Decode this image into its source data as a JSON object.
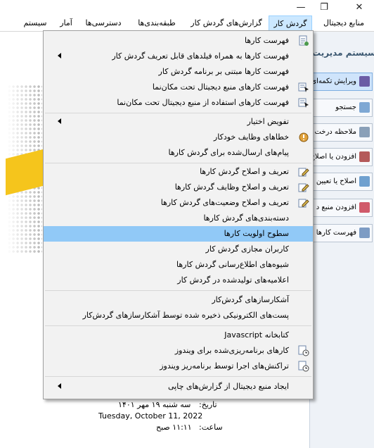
{
  "window": {
    "minimize": "—",
    "restore": "❐",
    "close": "✕"
  },
  "menubar": {
    "items": [
      {
        "label": "منابع دیجیتال",
        "active": false
      },
      {
        "label": "گردش کار",
        "active": true
      },
      {
        "label": "گزارش‌های گردش کار",
        "active": false
      },
      {
        "label": "طبقه‌بندی‌ها",
        "active": false
      },
      {
        "label": "دسترسی‌ها",
        "active": false
      },
      {
        "label": "آمار",
        "active": false
      },
      {
        "label": "سیستم",
        "active": false
      }
    ]
  },
  "right_panel": {
    "title": "سیستم مدیریت",
    "buttons": [
      {
        "label": "ویرایش تکمه‌ای",
        "selected": true
      },
      {
        "label": "جستجو",
        "selected": false
      },
      {
        "label": "ملاحظه درخت",
        "selected": false
      },
      {
        "label": "افزودن یا اصلاح",
        "selected": false
      },
      {
        "label": "اصلاح یا تعیین",
        "selected": false
      },
      {
        "label": "افزودن منبع د",
        "selected": false
      },
      {
        "label": "فهرست کارها",
        "selected": false
      }
    ]
  },
  "info": {
    "date_label": "تاریخ:",
    "date_value": "سه شنبه ۱۹ مهر ۱۴۰۱",
    "date_en": "Tuesday, October 11, 2022",
    "time_label": "ساعت:",
    "time_value": "۱۱:۱۱ صبح"
  },
  "menu": {
    "items": [
      {
        "label": "فهرست کارها",
        "icon": "list-icon",
        "submenu": false
      },
      {
        "label": "فهرست کارها به همراه فیلدهای قابل تعریف گردش کار",
        "icon": "",
        "submenu": true
      },
      {
        "label": "فهرست کارها مبتنی بر برنامه گردش کار",
        "icon": "",
        "submenu": false
      },
      {
        "label": "فهرست کارهای منبع دیجیتال تحت مکان‌نما",
        "icon": "cursor-list-icon",
        "submenu": false
      },
      {
        "label": "فهرست کارهای استفاده از منبع دیجیتال تحت مکان‌نما",
        "icon": "cursor-list-icon",
        "submenu": false
      },
      {
        "label": "تفویض اختیار",
        "icon": "",
        "submenu": true
      },
      {
        "label": "خطاهای وظایف خودکار",
        "icon": "error-icon",
        "submenu": false
      },
      {
        "label": "پیام‌های ارسال‌شده برای گردش کارها",
        "icon": "",
        "submenu": false
      },
      {
        "label": "تعریف و اصلاح گردش کارها",
        "icon": "edit-icon",
        "submenu": false
      },
      {
        "label": "تعریف و اصلاح وظایف گردش کارها",
        "icon": "edit-icon",
        "submenu": false
      },
      {
        "label": "تعریف و اصلاح وضعیت‌های گردش کارها",
        "icon": "edit-icon",
        "submenu": false
      },
      {
        "label": "دسته‌بندی‌های گردش کارها",
        "icon": "",
        "submenu": false
      },
      {
        "label": "سطوح اولویت کارها",
        "icon": "",
        "submenu": false,
        "highlight": true
      },
      {
        "label": "کاربران مجازی گردش کار",
        "icon": "",
        "submenu": false
      },
      {
        "label": "شیوه‌های اطلاع‌رسانی گردش کارها",
        "icon": "",
        "submenu": false
      },
      {
        "label": "اعلامیه‌های تولیدشده در گردش کار",
        "icon": "",
        "submenu": false
      },
      {
        "label": "آشکارسازهای گردش‌کار",
        "icon": "",
        "submenu": false
      },
      {
        "label": "پست‌های الکترونیکی ذخیره شده توسط آشکارسازهای گردش‌کار",
        "icon": "",
        "submenu": false
      },
      {
        "label": "کتابخانه Javascript",
        "icon": "",
        "submenu": false
      },
      {
        "label": "کارهای برنامه‌ریزی‌شده برای ویندوز",
        "icon": "schedule-icon",
        "submenu": false
      },
      {
        "label": "تراکنش‌های اجرا توسط برنامه‌ریز ویندوز",
        "icon": "schedule-icon",
        "submenu": false
      },
      {
        "label": "ایجاد منبع دیجیتال از گزارش‌های چاپی",
        "icon": "",
        "submenu": true
      }
    ]
  }
}
